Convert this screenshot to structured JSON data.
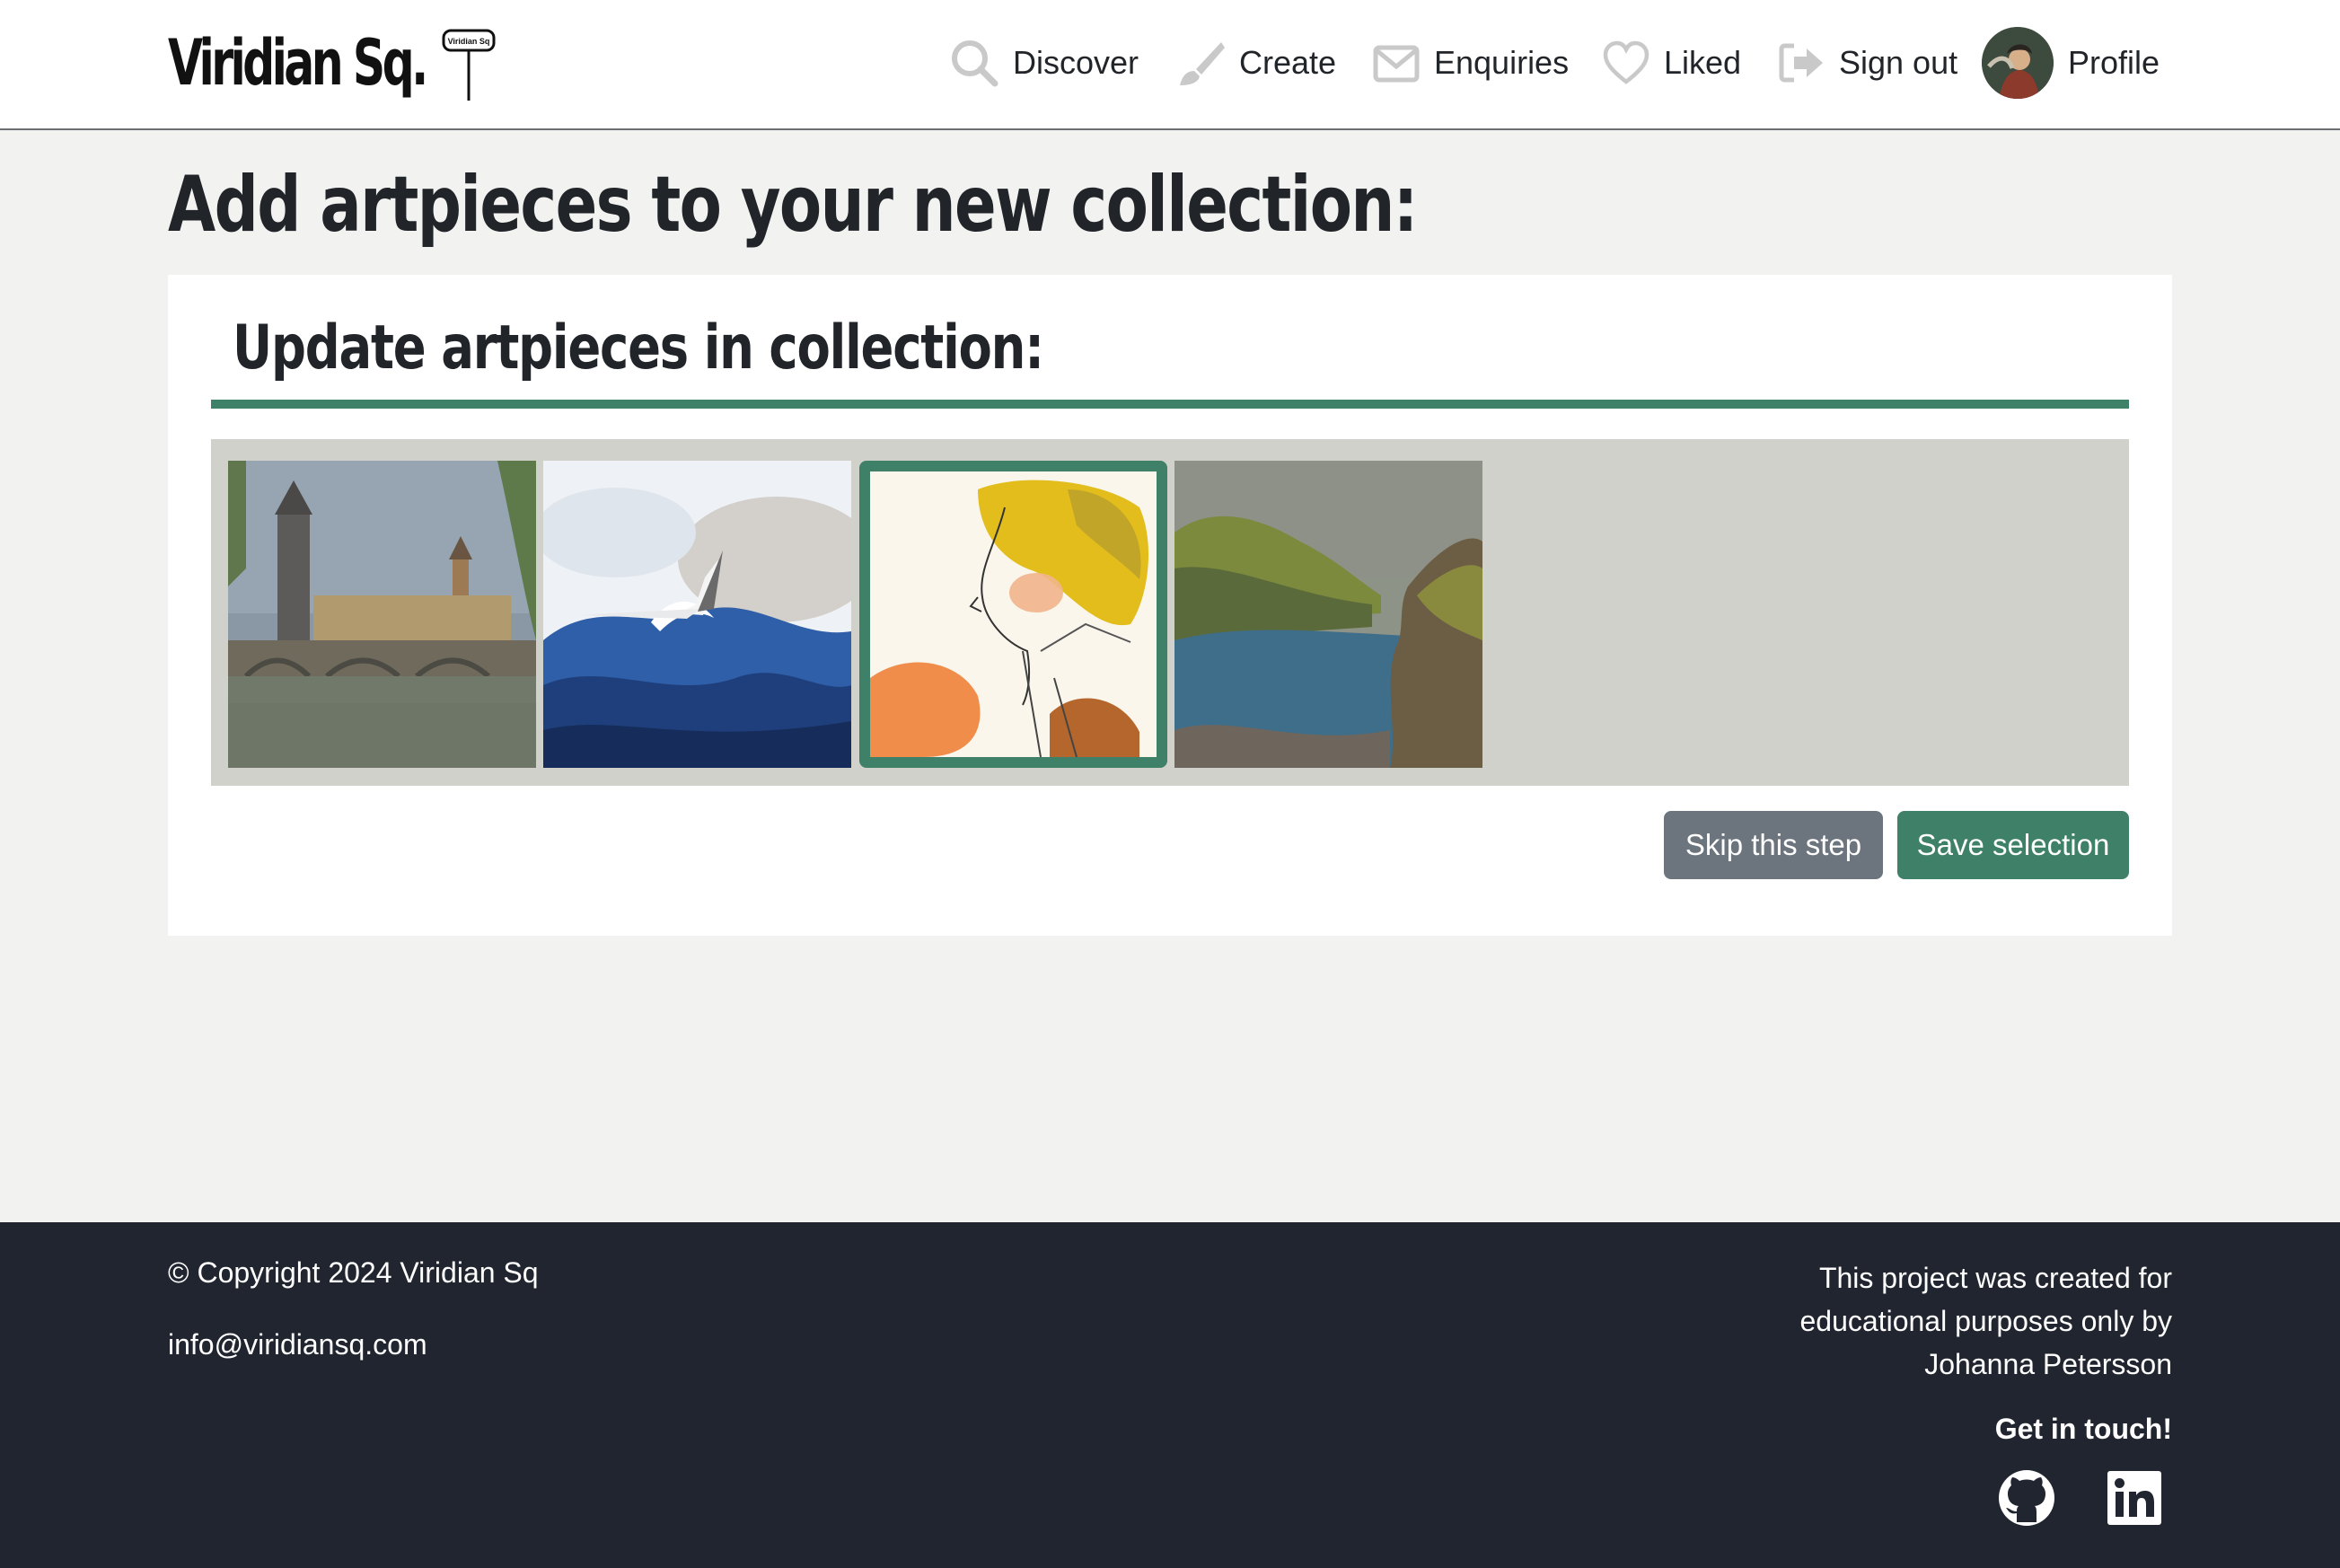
{
  "brand": {
    "name": "Viridian Sq.",
    "sign_text": "Viridian Sq"
  },
  "nav": {
    "discover": "Discover",
    "create": "Create",
    "enquiries": "Enquiries",
    "liked": "Liked",
    "sign_out": "Sign out",
    "profile": "Profile"
  },
  "main": {
    "title": "Add artpieces to your new collection:",
    "card_title": "Update artpieces in collection:",
    "artpieces": [
      {
        "icon": "bridge-cityscape-painting",
        "selected": false
      },
      {
        "icon": "seagull-waves-painting",
        "selected": false
      },
      {
        "icon": "woman-portrait-painting",
        "selected": true
      },
      {
        "icon": "coastal-cliffs-painting",
        "selected": false
      }
    ],
    "skip_label": "Skip this step",
    "save_label": "Save selection"
  },
  "footer": {
    "copyright": "© Copyright 2024 Viridian Sq",
    "email": "info@viridiansq.com",
    "about_lines": [
      "This project was created for",
      "educational purposes only by",
      "Johanna Petersson"
    ],
    "get_in_touch": "Get in touch!",
    "socials": [
      "github-icon",
      "linkedin-icon"
    ]
  },
  "colors": {
    "accent": "#3f8068",
    "gallery_bg": "#d1d1cb",
    "page_bg": "#f2f3f1",
    "footer_bg": "#21252f",
    "skip_button": "#6c757d"
  }
}
